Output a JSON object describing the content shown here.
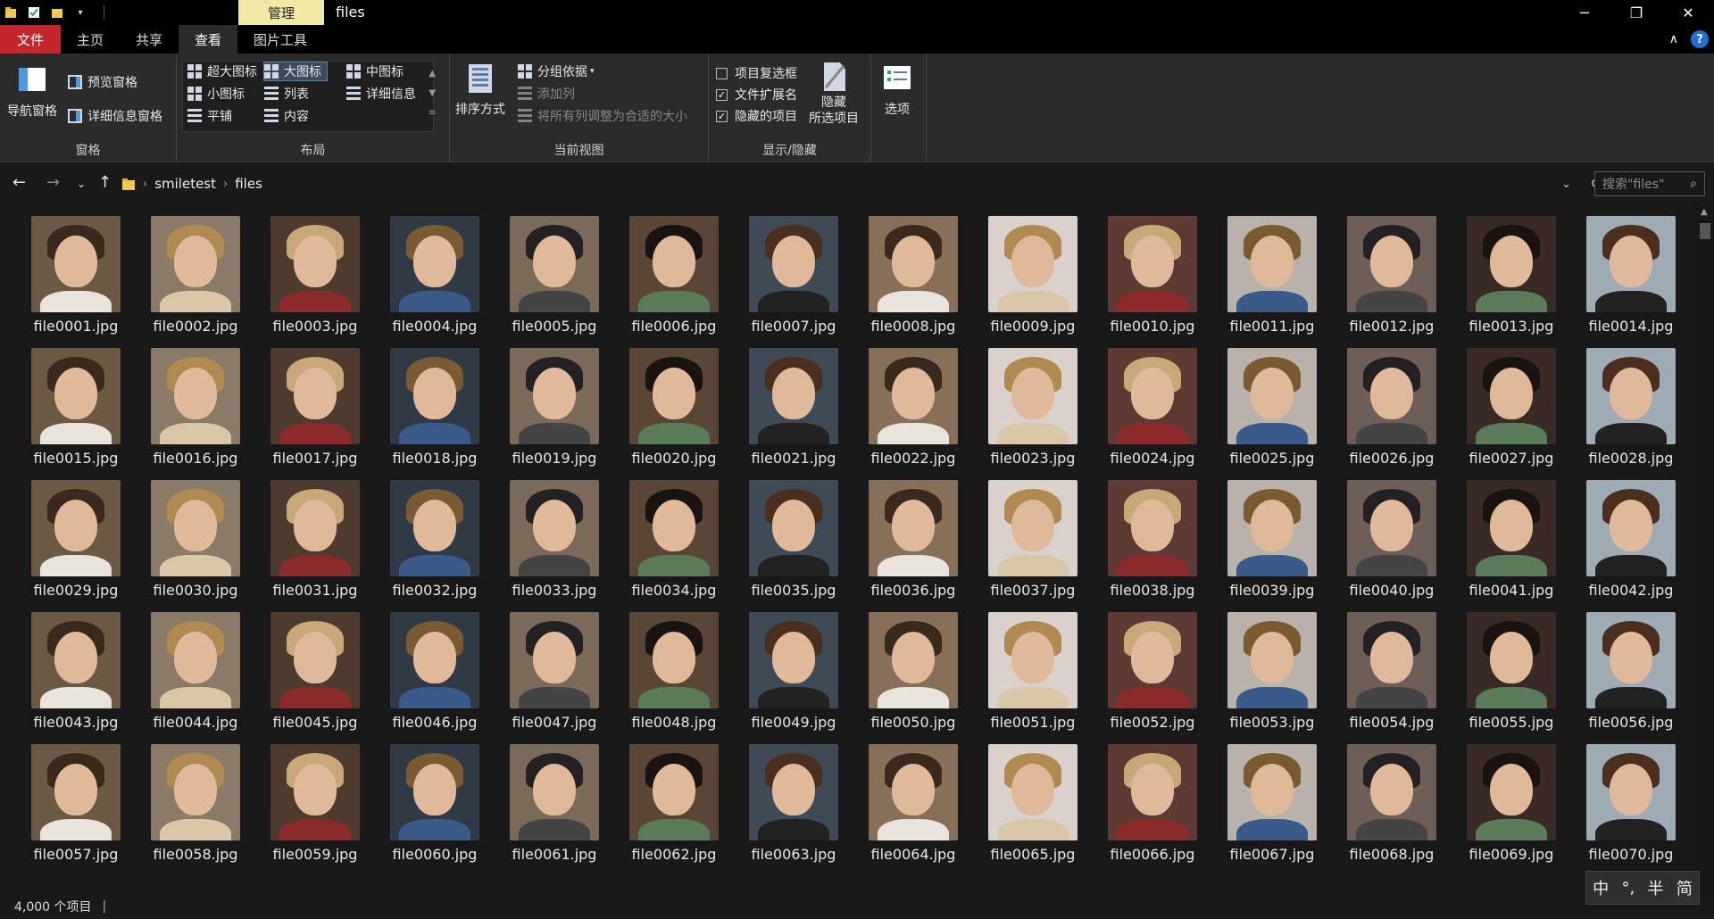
{
  "titlebar": {
    "context_tab": "管理",
    "title": "files",
    "minimize": "─",
    "restore": "❐",
    "close": "✕"
  },
  "tabs": {
    "file": "文件",
    "home": "主页",
    "share": "共享",
    "view": "查看",
    "picture_tools": "图片工具",
    "collapse": "∧",
    "help": "?"
  },
  "ribbon": {
    "panes": {
      "nav_pane": "导航窗格",
      "preview_pane": "预览窗格",
      "details_pane": "详细信息窗格",
      "label": "窗格"
    },
    "layout": {
      "extra_large": "超大图标",
      "large": "大图标",
      "medium": "中图标",
      "small": "小图标",
      "list": "列表",
      "details": "详细信息",
      "tiles": "平铺",
      "content": "内容",
      "label": "布局"
    },
    "current_view": {
      "sort_by": "排序方式",
      "group_by": "分组依据",
      "add_columns": "添加列",
      "size_all_columns": "将所有列调整为合适的大小",
      "label": "当前视图"
    },
    "show_hide": {
      "item_checkboxes": "项目复选框",
      "file_extensions": "文件扩展名",
      "hidden_items": "隐藏的项目",
      "hide_selected_1": "隐藏",
      "hide_selected_2": "所选项目",
      "label": "显示/隐藏"
    },
    "options": "选项"
  },
  "address": {
    "crumbs": [
      "smiletest",
      "files"
    ],
    "search_placeholder": "搜索\"files\""
  },
  "files": {
    "names": [
      "file0001.jpg",
      "file0002.jpg",
      "file0003.jpg",
      "file0004.jpg",
      "file0005.jpg",
      "file0006.jpg",
      "file0007.jpg",
      "file0008.jpg",
      "file0009.jpg",
      "file0010.jpg",
      "file0011.jpg",
      "file0012.jpg",
      "file0013.jpg",
      "file0014.jpg",
      "file0015.jpg",
      "file0016.jpg",
      "file0017.jpg",
      "file0018.jpg",
      "file0019.jpg",
      "file0020.jpg",
      "file0021.jpg",
      "file0022.jpg",
      "file0023.jpg",
      "file0024.jpg",
      "file0025.jpg",
      "file0026.jpg",
      "file0027.jpg",
      "file0028.jpg",
      "file0029.jpg",
      "file0030.jpg",
      "file0031.jpg",
      "file0032.jpg",
      "file0033.jpg",
      "file0034.jpg",
      "file0035.jpg",
      "file0036.jpg",
      "file0037.jpg",
      "file0038.jpg",
      "file0039.jpg",
      "file0040.jpg",
      "file0041.jpg",
      "file0042.jpg",
      "file0043.jpg",
      "file0044.jpg",
      "file0045.jpg",
      "file0046.jpg",
      "file0047.jpg",
      "file0048.jpg",
      "file0049.jpg",
      "file0050.jpg",
      "file0051.jpg",
      "file0052.jpg",
      "file0053.jpg",
      "file0054.jpg",
      "file0055.jpg",
      "file0056.jpg",
      "file0057.jpg",
      "file0058.jpg",
      "file0059.jpg",
      "file0060.jpg",
      "file0061.jpg",
      "file0062.jpg",
      "file0063.jpg",
      "file0064.jpg",
      "file0065.jpg",
      "file0066.jpg",
      "file0067.jpg",
      "file0068.jpg",
      "file0069.jpg",
      "file0070.jpg"
    ]
  },
  "status": {
    "count": "4,000 个项目",
    "separator": "|"
  },
  "ime": [
    "中",
    "°,",
    "半",
    "简"
  ],
  "colors": {
    "file_tab": "#c4262e",
    "context_tab": "#f1e8a3",
    "background": "#191919",
    "ribbon": "#2b2b2b"
  }
}
